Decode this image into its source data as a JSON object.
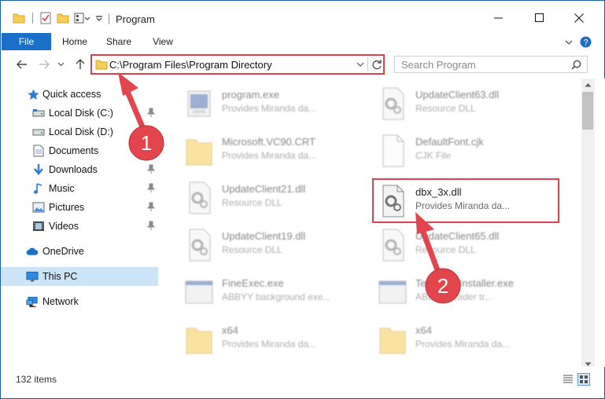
{
  "window": {
    "title": "Program",
    "accent": "#1e5ea8",
    "controls": [
      "minimize-icon",
      "maximize-icon",
      "close-icon"
    ]
  },
  "ribbon": {
    "tabs": [
      {
        "label": "File",
        "active": true
      },
      {
        "label": "Home"
      },
      {
        "label": "Share"
      },
      {
        "label": "View"
      }
    ]
  },
  "address": {
    "path": "C:\\Program Files\\Program Directory",
    "search_placeholder": "Search Program"
  },
  "nav": {
    "items": [
      {
        "label": "Quick access",
        "icon": "star-icon"
      },
      {
        "label": "Local Disk (C:)",
        "icon": "drive-icon",
        "pinned": true
      },
      {
        "label": "Local Disk (D:)",
        "icon": "drive-icon"
      },
      {
        "label": "Documents",
        "icon": "documents-icon"
      },
      {
        "label": "Downloads",
        "icon": "download-icon",
        "pinned": true
      },
      {
        "label": "Music",
        "icon": "music-icon",
        "pinned": true
      },
      {
        "label": "Pictures",
        "icon": "pictures-icon",
        "pinned": true
      },
      {
        "label": "Videos",
        "icon": "video-icon",
        "pinned": true
      },
      {
        "label": "OneDrive",
        "icon": "cloud-icon"
      },
      {
        "label": "This PC",
        "icon": "computer-icon",
        "selected": true
      },
      {
        "label": "Network",
        "icon": "network-icon"
      }
    ]
  },
  "files": [
    {
      "name": "program.exe",
      "desc": "Provides Miranda da...",
      "icon": "exe-icon"
    },
    {
      "name": "UpdateClient63.dll",
      "desc": "Resource DLL",
      "icon": "dll-icon"
    },
    {
      "name": "Microsoft.VC90.CRT",
      "desc": "Provides Miranda da...",
      "icon": "folder-icon"
    },
    {
      "name": "DefaultFont.cjk",
      "desc": "CJK File",
      "icon": "file-icon"
    },
    {
      "name": "UpdateClient21.dll",
      "desc": "Resource DLL",
      "icon": "dll-icon"
    },
    {
      "name": "dbx_3x.dll",
      "desc": "Provides Miranda da...",
      "icon": "dll-icon",
      "highlighted": true
    },
    {
      "name": "UpdateClient19.dll",
      "desc": "Resource DLL",
      "icon": "dll-icon"
    },
    {
      "name": "UpdateClient65.dll",
      "desc": "Resource DLL",
      "icon": "dll-icon"
    },
    {
      "name": "FineExec.exe",
      "desc": "ABBYY background exe...",
      "icon": "exe-icon"
    },
    {
      "name": "TesseractInstaller.exe",
      "desc": "ABBYY reader tr...",
      "icon": "exe-icon"
    },
    {
      "name": "x64",
      "desc": "Provides Miranda da...",
      "icon": "folder-icon"
    },
    {
      "name": "x64",
      "desc": "Provides Miranda da...",
      "icon": "folder-icon"
    }
  ],
  "status": {
    "item_count": "132 items"
  },
  "annotations": {
    "callout_1": "1",
    "callout_2": "2",
    "color": "#d9434b"
  }
}
